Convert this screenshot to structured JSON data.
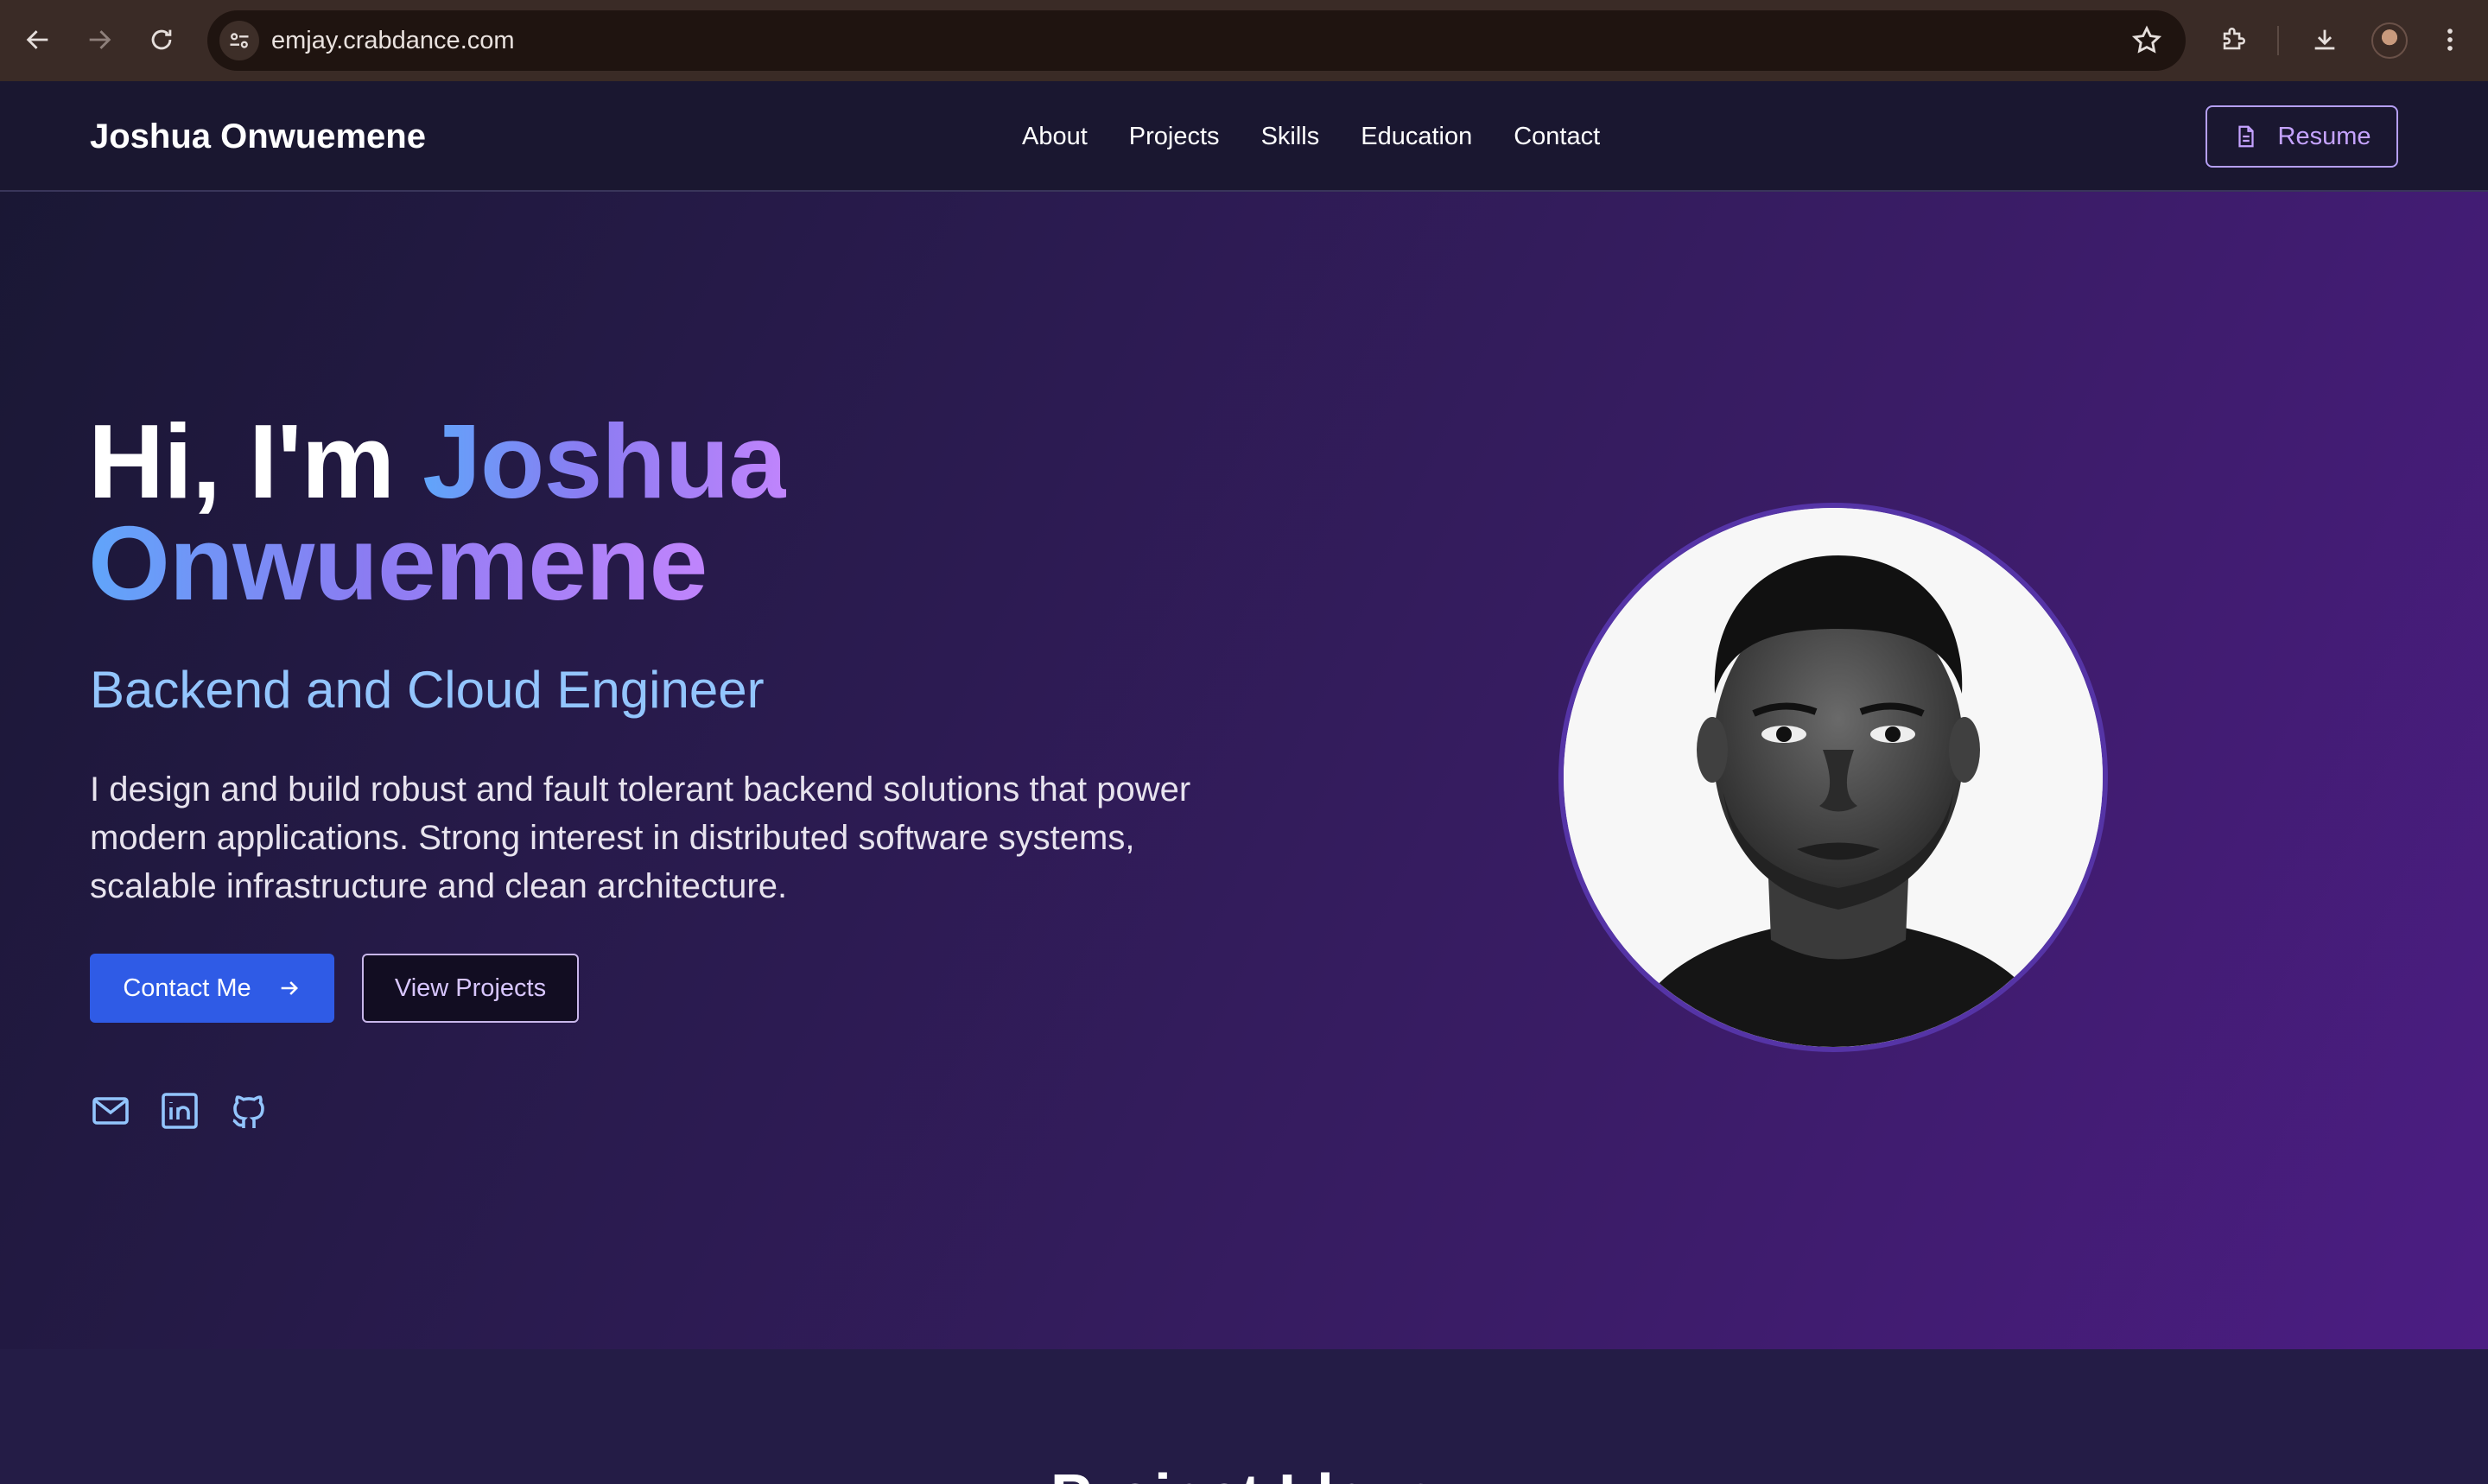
{
  "browser": {
    "url": "emjay.crabdance.com",
    "icons": [
      "back-icon",
      "forward-icon",
      "reload-icon",
      "site-info-icon",
      "bookmark-star-icon",
      "extensions-icon",
      "download-icon",
      "profile-avatar",
      "menu-icon"
    ]
  },
  "nav": {
    "brand": "Joshua Onwuemene",
    "links": [
      "About",
      "Projects",
      "Skills",
      "Education",
      "Contact"
    ],
    "resume_label": "Resume"
  },
  "hero": {
    "greeting": "Hi, I'm ",
    "first_name": "Joshua",
    "last_name": "Onwuemene",
    "role": "Backend and Cloud Engineer",
    "bio": "I design and build robust and fault tolerant backend solutions that power modern applications. Strong interest in distributed software systems, scalable infrastructure and clean architecture.",
    "contact_label": "Contact Me",
    "projects_label": "View Projects",
    "socials": [
      "mail-icon",
      "linkedin-icon",
      "github-icon"
    ]
  },
  "next_section": {
    "title": "Project Ideas"
  },
  "colors": {
    "accent_blue": "#2f5be6",
    "gradient_start": "#60a5fa",
    "gradient_end": "#c084fc",
    "role_color": "#93c5fd"
  }
}
